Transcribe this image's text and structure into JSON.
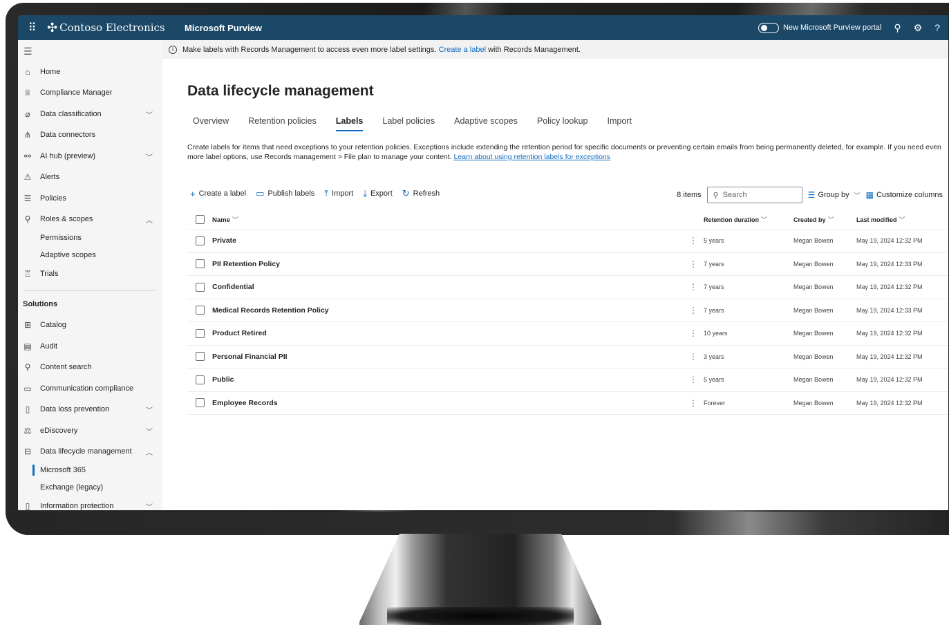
{
  "topbar": {
    "org_name": "Contoso Electronics",
    "product": "Microsoft Purview",
    "portal_toggle_label": "New Microsoft Purview portal"
  },
  "sidebar": {
    "items": [
      {
        "label": "Home",
        "icon": "home-icon"
      },
      {
        "label": "Compliance Manager",
        "icon": "trophy-icon"
      },
      {
        "label": "Data classification",
        "icon": "tag-icon",
        "chevron": "down"
      },
      {
        "label": "Data connectors",
        "icon": "connector-icon"
      },
      {
        "label": "AI hub (preview)",
        "icon": "ai-hub-icon",
        "chevron": "down"
      },
      {
        "label": "Alerts",
        "icon": "alert-icon"
      },
      {
        "label": "Policies",
        "icon": "policies-icon"
      },
      {
        "label": "Roles & scopes",
        "icon": "roles-icon",
        "chevron": "up"
      },
      {
        "label": "Permissions",
        "sub": true
      },
      {
        "label": "Adaptive scopes",
        "sub": true
      },
      {
        "label": "Trials",
        "icon": "trials-icon"
      }
    ],
    "solutions_heading": "Solutions",
    "solutions": [
      {
        "label": "Catalog",
        "icon": "catalog-icon"
      },
      {
        "label": "Audit",
        "icon": "audit-icon"
      },
      {
        "label": "Content search",
        "icon": "search-icon"
      },
      {
        "label": "Communication compliance",
        "icon": "communication-icon"
      },
      {
        "label": "Data loss prevention",
        "icon": "dlp-icon",
        "chevron": "down"
      },
      {
        "label": "eDiscovery",
        "icon": "ediscovery-icon",
        "chevron": "down"
      },
      {
        "label": "Data lifecycle management",
        "icon": "lifecycle-icon",
        "chevron": "up"
      },
      {
        "label": "Microsoft 365",
        "sub": true,
        "active": true
      },
      {
        "label": "Exchange (legacy)",
        "sub": true
      },
      {
        "label": "Information protection",
        "icon": "info-protection-icon",
        "chevron": "down"
      }
    ]
  },
  "banner": {
    "text_before": "Make labels with Records Management to access even more label settings.",
    "link": "Create a label",
    "text_after": "with Records Management."
  },
  "page": {
    "title": "Data lifecycle management",
    "tabs": [
      "Overview",
      "Retention policies",
      "Labels",
      "Label policies",
      "Adaptive scopes",
      "Policy lookup",
      "Import"
    ],
    "active_tab": "Labels",
    "description": "Create labels for items that need exceptions to your retention policies. Exceptions include extending the retention period for specific documents or preventing certain emails from being permanently deleted, for example. If you need even more label options, use Records management > File plan to manage your content.",
    "description_link": "Learn about using retention labels for exceptions"
  },
  "toolbar": {
    "create": "Create a label",
    "publish": "Publish labels",
    "import": "Import",
    "export": "Export",
    "refresh": "Refresh",
    "count": "8 items",
    "search_placeholder": "Search",
    "group_by": "Group by",
    "customize": "Customize columns"
  },
  "table": {
    "columns": [
      "Name",
      "Retention duration",
      "Created by",
      "Last modified"
    ],
    "rows": [
      {
        "name": "Private",
        "retention": "5 years",
        "created_by": "Megan Bowen",
        "modified": "May 19, 2024 12:32 PM"
      },
      {
        "name": "PII Retention Policy",
        "retention": "7 years",
        "created_by": "Megan Bowen",
        "modified": "May 19, 2024 12:33 PM"
      },
      {
        "name": "Confidential",
        "retention": "7 years",
        "created_by": "Megan Bowen",
        "modified": "May 19, 2024 12:32 PM"
      },
      {
        "name": "Medical Records Retention Policy",
        "retention": "7 years",
        "created_by": "Megan Bowen",
        "modified": "May 19, 2024 12:33 PM"
      },
      {
        "name": "Product Retired",
        "retention": "10 years",
        "created_by": "Megan Bowen",
        "modified": "May 19, 2024 12:32 PM"
      },
      {
        "name": "Personal Financial PII",
        "retention": "3 years",
        "created_by": "Megan Bowen",
        "modified": "May 19, 2024 12:32 PM"
      },
      {
        "name": "Public",
        "retention": "5 years",
        "created_by": "Megan Bowen",
        "modified": "May 19, 2024 12:32 PM"
      },
      {
        "name": "Employee Records",
        "retention": "Forever",
        "created_by": "Megan Bowen",
        "modified": "May 19, 2024 12:32 PM"
      }
    ]
  },
  "colors": {
    "topbar": "#1c4867",
    "accent": "#0f6cbd",
    "sidebar_bg": "#f5f5f5"
  }
}
